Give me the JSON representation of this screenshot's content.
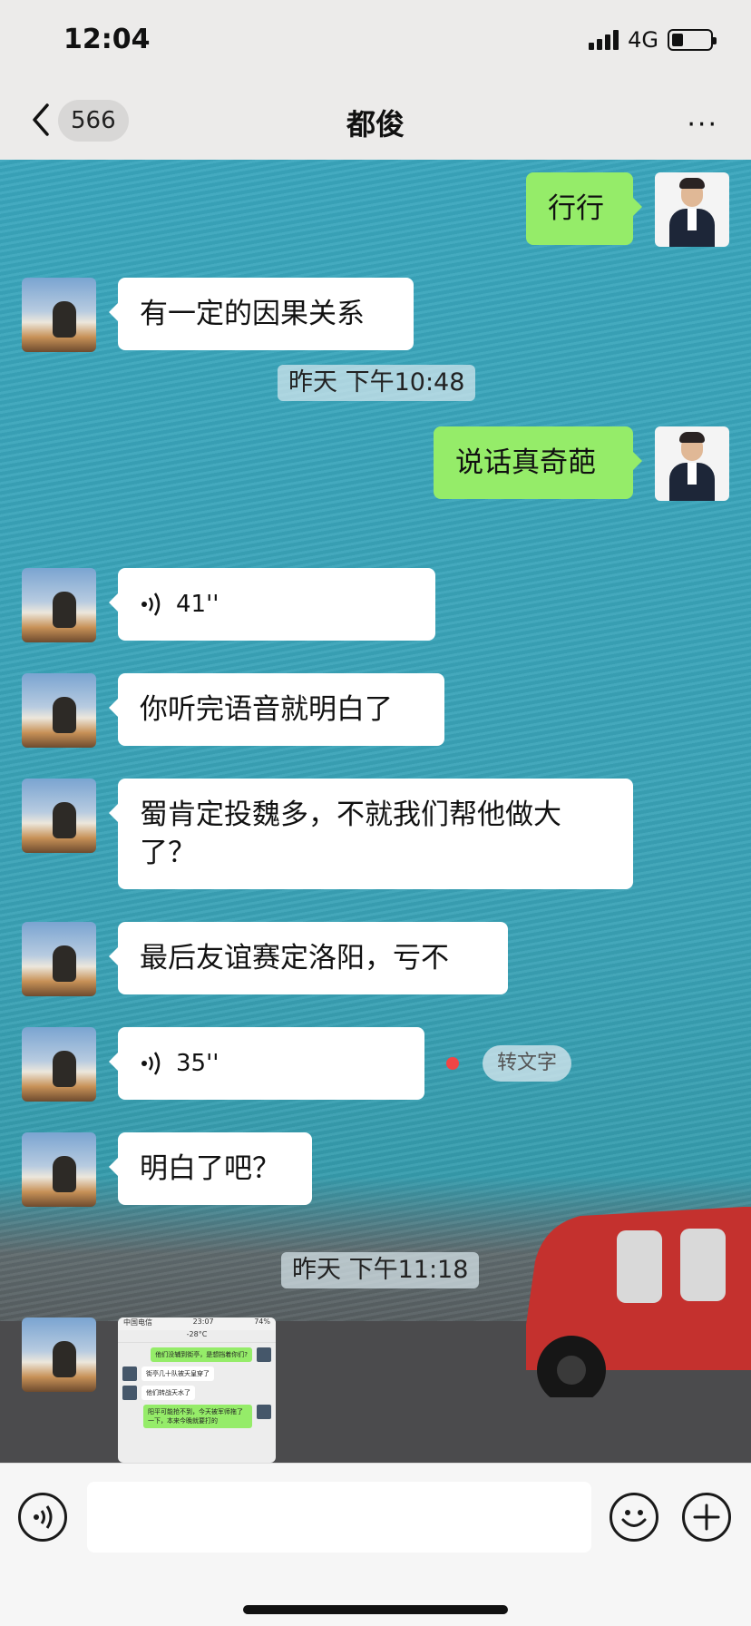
{
  "status": {
    "time": "12:04",
    "network": "4G"
  },
  "nav": {
    "badge": "566",
    "title": "都俊",
    "more": "···"
  },
  "messages": [
    {
      "text": "行行"
    },
    {
      "text": "有一定的因果关系"
    },
    {
      "text": "昨天 下午10:48"
    },
    {
      "text": "说话真奇葩"
    },
    {
      "text": "41''"
    },
    {
      "text": "你听完语音就明白了"
    },
    {
      "text": "蜀肯定投魏多，不就我们帮他做大了？"
    },
    {
      "text": "最后友谊赛定洛阳，亏不"
    },
    {
      "text": "35''",
      "to_text": "转文字"
    },
    {
      "text": "明白了吧？"
    },
    {
      "text": "昨天 下午11:18"
    }
  ],
  "thumbnail": {
    "carrier": "中国电信",
    "time": "23:07",
    "battery": "74%",
    "title": "-28°C",
    "lines": [
      "他们没辅到街亭，是想挡着你们?",
      "街亭几十队被天皇穿了",
      "他们转战天水了",
      "阳平可能抢不到，今天被军师拖了一下，本来今晚就要打的"
    ]
  }
}
